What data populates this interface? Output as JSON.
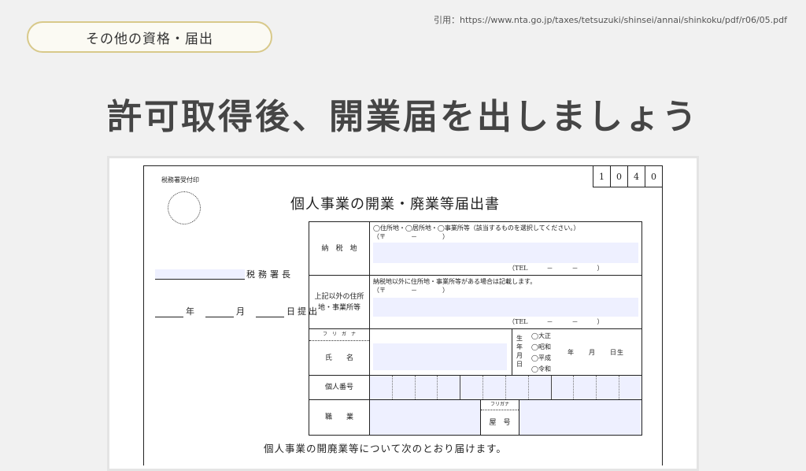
{
  "header": {
    "badge": "その他の資格・届出",
    "citation": "引用：https://www.nta.go.jp/taxes/tetsuzuki/shinsei/annai/shinkoku/pdf/r06/05.pdf",
    "title": "許可取得後、開業届を出しましょう"
  },
  "form": {
    "stamp_label": "税務署受付印",
    "code_digits": [
      "1",
      "0",
      "4",
      "0"
    ],
    "title": "個人事業の開業・廃業等届出書",
    "office_suffix": "税務署長",
    "date_year": "年",
    "date_month": "月",
    "date_submit": "日提出",
    "rows": {
      "tax_place_label": "納　税　地",
      "tax_place_options": "◯住所地・◯居所地・◯事業所等（該当するものを選択してください。）",
      "postal": "（〒　　　　－　　　　）",
      "tel": "（TEL　　　－　　　－　　　）",
      "other_label": "上記以外の住所地・事業所等",
      "other_note": "納税地以外に住所地・事業所等がある場合は記載します。",
      "furigana": "フ　リ　ガ　ナ",
      "name_label": "氏　　名",
      "birth_label": "生年月日",
      "eras": [
        "◯大正",
        "◯昭和",
        "◯平成",
        "◯令和"
      ],
      "ymd": "年　　月　　日生",
      "mynumber_label": "個人番号",
      "job_label": "職　　業",
      "shop_furigana": "フリガナ",
      "shop_label": "屋　号"
    },
    "footer": "個人事業の開廃業等について次のとおり届けます。"
  }
}
